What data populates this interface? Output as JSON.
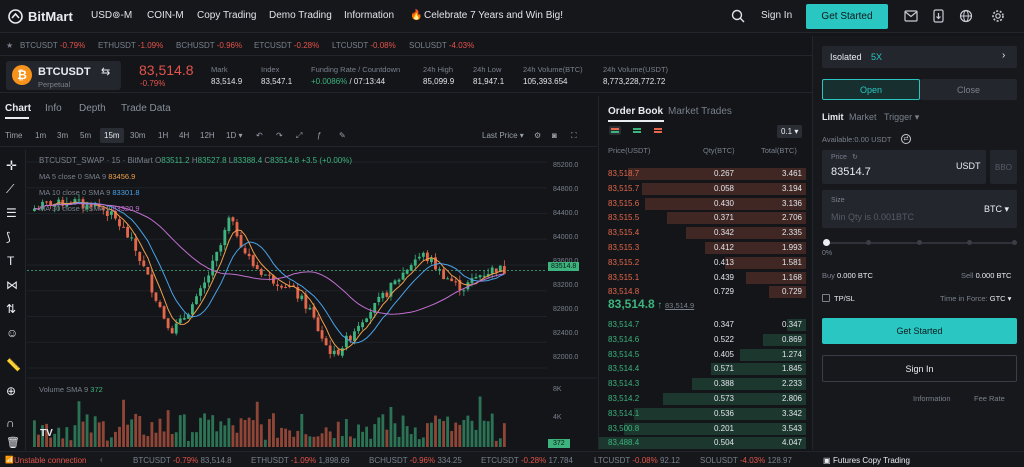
{
  "nav": {
    "logo_text": "BitMart",
    "items": [
      "USD⊚-M",
      "COIN-M",
      "Copy Trading",
      "Demo Trading",
      "Information"
    ],
    "promo": "Celebrate 7 Years and Win Big!",
    "sign_in": "Sign In",
    "get_started": "Get Started"
  },
  "ticker": [
    {
      "sym": "BTCUSDT",
      "chg": "-0.79%"
    },
    {
      "sym": "ETHUSDT",
      "chg": "-1.09%"
    },
    {
      "sym": "BCHUSDT",
      "chg": "-0.96%"
    },
    {
      "sym": "ETCUSDT",
      "chg": "-0.28%"
    },
    {
      "sym": "LTCUSDT",
      "chg": "-0.08%"
    },
    {
      "sym": "SOLUSDT",
      "chg": "-4.03%"
    }
  ],
  "market": {
    "pair": "BTCUSDT",
    "type": "Perpetual",
    "price": "83,514.8",
    "change": "-0.79%",
    "stats": [
      {
        "label": "Mark",
        "value": "83,514.9"
      },
      {
        "label": "Index",
        "value": "83,547.1"
      },
      {
        "label": "Funding Rate / Countdown",
        "value": "+0.0086%",
        "value2": " / 07:13:44"
      },
      {
        "label": "24h High",
        "value": "85,099.9"
      },
      {
        "label": "24h Low",
        "value": "81,947.1"
      },
      {
        "label": "24h Volume(BTC)",
        "value": "105,393.654"
      },
      {
        "label": "24h Volume(USDT)",
        "value": "8,773,228,772.72"
      }
    ]
  },
  "tabs": [
    "Chart",
    "Info",
    "Depth",
    "Trade Data"
  ],
  "chart_toolbar": {
    "time": "Time",
    "intervals": [
      "1m",
      "3m",
      "5m",
      "15m",
      "30m",
      "1H",
      "4H",
      "12H",
      "1D"
    ],
    "active_interval": "15m",
    "last_price": "Last Price"
  },
  "chart_legend": {
    "title": "BTCUSDT_SWAP · 15 · BitMart",
    "o": "83511.2",
    "h": "83527.8",
    "l": "83388.4",
    "c": "83514.8",
    "change": "+3.5 (+0.00%)",
    "ma5_label": "MA 5 close 0 SMA 9",
    "ma5_value": "83456.9",
    "ma10_label": "MA 10 close 0 SMA 9",
    "ma10_value": "83301.8",
    "ma30_label": "MA 30 close 0 SMA 9",
    "ma30_value": "83320.9",
    "volume_label": "Volume SMA 9",
    "volume_value": "372",
    "price_axis": [
      "85200.0",
      "84800.0",
      "84400.0",
      "84000.0",
      "83600.0",
      "83200.0",
      "82800.0",
      "82400.0",
      "82000.0"
    ],
    "current_price_tag": "83514.8",
    "volume_axis": [
      "8K",
      "4K"
    ],
    "volume_tag": "372",
    "colors": {
      "up": "#3db37d",
      "down": "#e5674b",
      "ma5": "#f0a04b",
      "ma10": "#4aa3e8",
      "ma30": "#c26fd1"
    }
  },
  "chart_data": {
    "type": "candlestick",
    "interval": "15m",
    "close": [
      84480,
      84520,
      84560,
      84540,
      84600,
      84580,
      84520,
      84560,
      84500,
      84420,
      84300,
      84150,
      83950,
      83700,
      83400,
      83100,
      82800,
      82600,
      82700,
      82900,
      83050,
      83300,
      83600,
      83900,
      84300,
      84100,
      83800,
      83600,
      83500,
      83400,
      83350,
      83300,
      83200,
      83050,
      82900,
      82600,
      82350,
      82200,
      82350,
      82500,
      82700,
      82850,
      82950,
      83100,
      83250,
      83400,
      83550,
      83700,
      83750,
      83650,
      83500,
      83400,
      83300,
      83250,
      83350,
      83450,
      83500,
      83550,
      83514.8
    ],
    "price_ticks": [
      85200,
      84800,
      84400,
      84000,
      83600,
      83200,
      82800,
      82400,
      82000
    ],
    "volume_ticks": [
      8000,
      4000
    ]
  },
  "orderbook": {
    "tabs": [
      "Order Book",
      "Market Trades"
    ],
    "precision": "0.1",
    "headers": [
      "Price(USDT)",
      "Qty(BTC)",
      "Total(BTC)"
    ],
    "asks": [
      [
        "83,518.7",
        "0.267",
        "3.461",
        0.86
      ],
      [
        "83,515.7",
        "0.058",
        "3.194",
        0.79
      ],
      [
        "83,515.6",
        "0.430",
        "3.136",
        0.78
      ],
      [
        "83,515.5",
        "0.371",
        "2.706",
        0.67
      ],
      [
        "83,515.4",
        "0.342",
        "2.335",
        0.58
      ],
      [
        "83,515.3",
        "0.412",
        "1.993",
        0.49
      ],
      [
        "83,515.2",
        "0.413",
        "1.581",
        0.39
      ],
      [
        "83,515.1",
        "0.439",
        "1.168",
        0.29
      ],
      [
        "83,514.8",
        "0.729",
        "0.729",
        0.18
      ]
    ],
    "mid_price": "83,514.8",
    "mid_mark": "83,514.9",
    "bids": [
      [
        "83,514.7",
        "0.347",
        "0.347",
        0.09
      ],
      [
        "83,514.6",
        "0.522",
        "0.869",
        0.21
      ],
      [
        "83,514.5",
        "0.405",
        "1.274",
        0.32
      ],
      [
        "83,514.4",
        "0.571",
        "1.845",
        0.46
      ],
      [
        "83,514.3",
        "0.388",
        "2.233",
        0.55
      ],
      [
        "83,514.2",
        "0.573",
        "2.806",
        0.69
      ],
      [
        "83,514.1",
        "0.536",
        "3.342",
        0.83
      ],
      [
        "83,500.8",
        "0.201",
        "3.543",
        0.88
      ],
      [
        "83,488.4",
        "0.504",
        "4.047",
        1.0
      ]
    ]
  },
  "trade_panel": {
    "margin_mode": "Isolated",
    "leverage": "5X",
    "open": "Open",
    "close": "Close",
    "order_types": [
      "Limit",
      "Market",
      "Trigger"
    ],
    "available": "Available:0.00 USDT",
    "price_label": "Price",
    "price_value": "83514.7",
    "price_unit": "USDT",
    "bbo": "BBO",
    "size_label": "Size",
    "size_placeholder": "Min Qty is 0.001BTC",
    "size_unit": "BTC",
    "slider_pct": "0%",
    "buy": "Buy",
    "buy_value": "0.000 BTC",
    "sell": "Sell",
    "sell_value": "0.000 BTC",
    "tpsl": "TP/SL",
    "time_in_force": "Time in Force:",
    "tif_value": "GTC",
    "get_started": "Get Started",
    "sign_in": "Sign In",
    "information": "Information",
    "fee_rate": "Fee Rate"
  },
  "bottom": {
    "status": "Unstable connection",
    "ticker": [
      {
        "sym": "BTCUSDT",
        "chg": "-0.79%",
        "price": "83,514.8"
      },
      {
        "sym": "ETHUSDT",
        "chg": "-1.09%",
        "price": "1,898.69"
      },
      {
        "sym": "BCHUSDT",
        "chg": "-0.96%",
        "price": "334.25"
      },
      {
        "sym": "ETCUSDT",
        "chg": "-0.28%",
        "price": "17.784"
      },
      {
        "sym": "LTCUSDT",
        "chg": "-0.08%",
        "price": "92.12"
      },
      {
        "sym": "SOLUSDT",
        "chg": "-4.03%",
        "price": "128.97"
      }
    ],
    "futures_copy": "Futures Copy Trading"
  }
}
